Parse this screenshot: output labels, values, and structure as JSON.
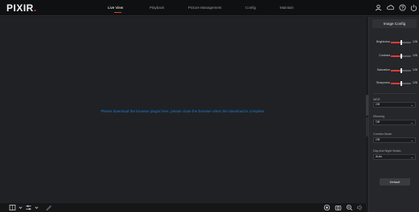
{
  "app": {
    "brand_main": "PIXIR",
    "brand_dot": "."
  },
  "nav": {
    "items": [
      {
        "label": "Live View"
      },
      {
        "label": "Playback"
      },
      {
        "label": "Picture Management"
      },
      {
        "label": "Config"
      },
      {
        "label": "Maintain"
      }
    ],
    "active_index": 0
  },
  "viewer": {
    "message": "Please download the browser plugin here, please close the browser when the download is complete."
  },
  "panel": {
    "title": "Image Config",
    "sliders": [
      {
        "label": "Brightness",
        "value": "128",
        "fraction": 0.5
      },
      {
        "label": "Contrast",
        "value": "128",
        "fraction": 0.5
      },
      {
        "label": "Saturation",
        "value": "128",
        "fraction": 0.5
      },
      {
        "label": "Sharpness",
        "value": "128",
        "fraction": 0.5
      }
    ],
    "fields": [
      {
        "label": "WDR",
        "value": "Off"
      },
      {
        "label": "Mirroring",
        "value": "Off"
      },
      {
        "label": "Corridor Mode",
        "value": "Off"
      },
      {
        "label": "Day And Night Switch",
        "value": "Auto"
      }
    ],
    "default_label": "Default"
  },
  "colors": {
    "accent": "#e53935",
    "link": "#1a7fd4"
  },
  "icons": {
    "top": [
      "user-icon",
      "cloud-icon",
      "help-icon",
      "power-icon"
    ],
    "bottom_left": [
      "screen-layout-icon",
      "stream-icon",
      "pen-icon"
    ],
    "bottom_right": [
      "record-icon",
      "camera-icon",
      "zoom-icon",
      "audio-icon"
    ]
  }
}
